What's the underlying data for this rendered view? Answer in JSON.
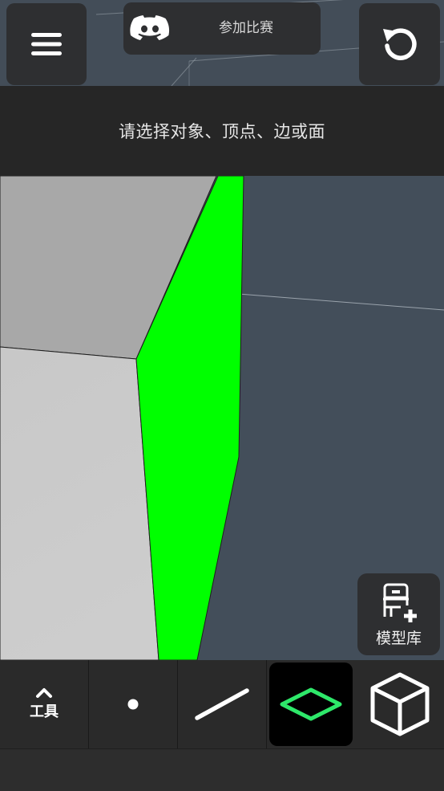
{
  "header": {
    "discord_label": "参加比赛",
    "prompt": "请选择对象、顶点、边或面"
  },
  "library": {
    "label": "模型库"
  },
  "toolbar": {
    "tools_label": "工具",
    "selected_mode": "face"
  },
  "colors": {
    "selected_face": "#00ff00",
    "accent": "#2ee86a",
    "viewport_bg": "#434d58",
    "panel_bg": "#2e2f31"
  },
  "icons": {
    "menu": "hamburger-icon",
    "discord": "discord-icon",
    "undo": "undo-icon",
    "library": "chair-plus-icon",
    "tools": "chevron-up-icon",
    "vertex": "dot-icon",
    "edge": "line-icon",
    "face": "diamond-icon",
    "object": "cube-icon"
  }
}
